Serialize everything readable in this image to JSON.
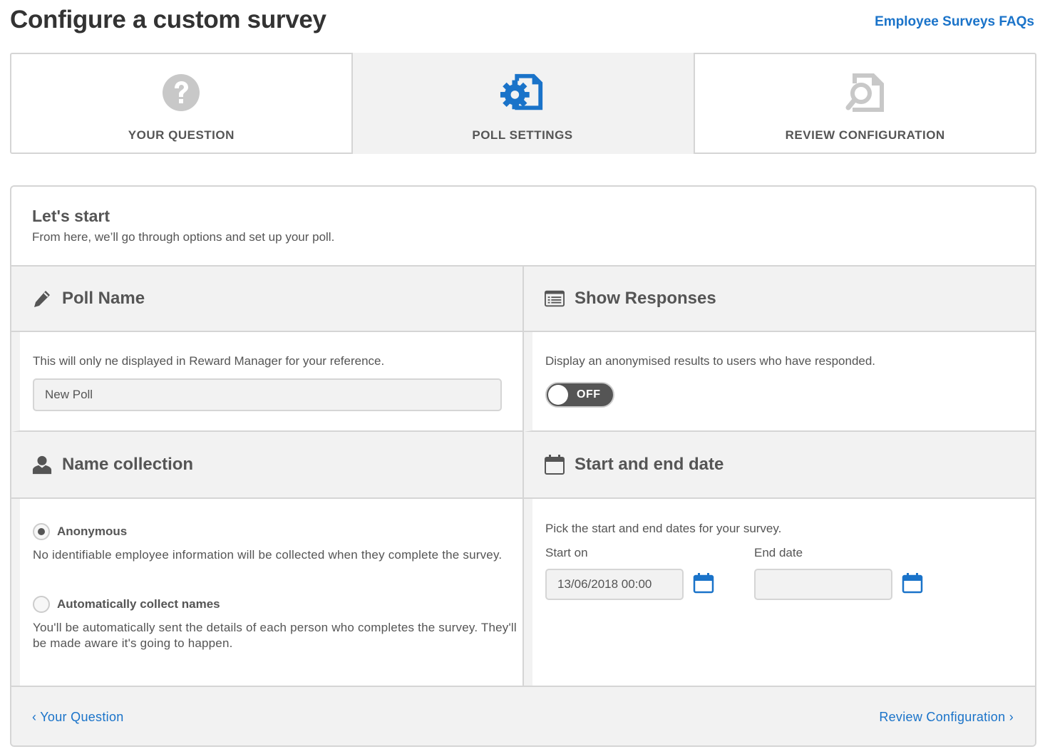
{
  "header": {
    "title": "Configure a custom survey",
    "faq_link": "Employee Surveys FAQs"
  },
  "steps": [
    {
      "label": "YOUR QUESTION",
      "icon": "question-circle-icon",
      "active": false
    },
    {
      "label": "POLL SETTINGS",
      "icon": "document-gear-icon",
      "active": true
    },
    {
      "label": "REVIEW CONFIGURATION",
      "icon": "document-search-icon",
      "active": false
    }
  ],
  "intro": {
    "title": "Let's start",
    "subtitle": "From here, we’ll go through options and set up your poll."
  },
  "poll_name": {
    "title": "Poll Name",
    "icon": "pencil-icon",
    "description": "This will only ne displayed in Reward Manager for your reference.",
    "value": "New Poll"
  },
  "show_responses": {
    "title": "Show Responses",
    "icon": "list-icon",
    "description": "Display an anonymised results to users who have responded.",
    "toggle_label": "OFF"
  },
  "name_collection": {
    "title": "Name collection",
    "icon": "user-icon",
    "options": [
      {
        "label": "Anonymous",
        "description": "No identifiable employee information will be collected when they complete the survey.",
        "checked": true
      },
      {
        "label": "Automatically collect names",
        "description": "You'll be automatically sent the details of each person who completes the survey. They'll be made aware it's going to happen.",
        "checked": false
      }
    ]
  },
  "dates": {
    "title": "Start and end date",
    "icon": "calendar-icon",
    "description": "Pick the start and end dates for your survey.",
    "start_label": "Start on",
    "start_value": "13/06/2018 00:00",
    "end_label": "End date",
    "end_value": ""
  },
  "footer": {
    "back_label": "‹ Your Question",
    "next_label": "Review Configuration ›"
  },
  "colors": {
    "link": "#1a73c9",
    "active_icon": "#1a73c9",
    "inactive_icon": "#c8c8c8",
    "panel_grey": "#f2f2f2"
  }
}
